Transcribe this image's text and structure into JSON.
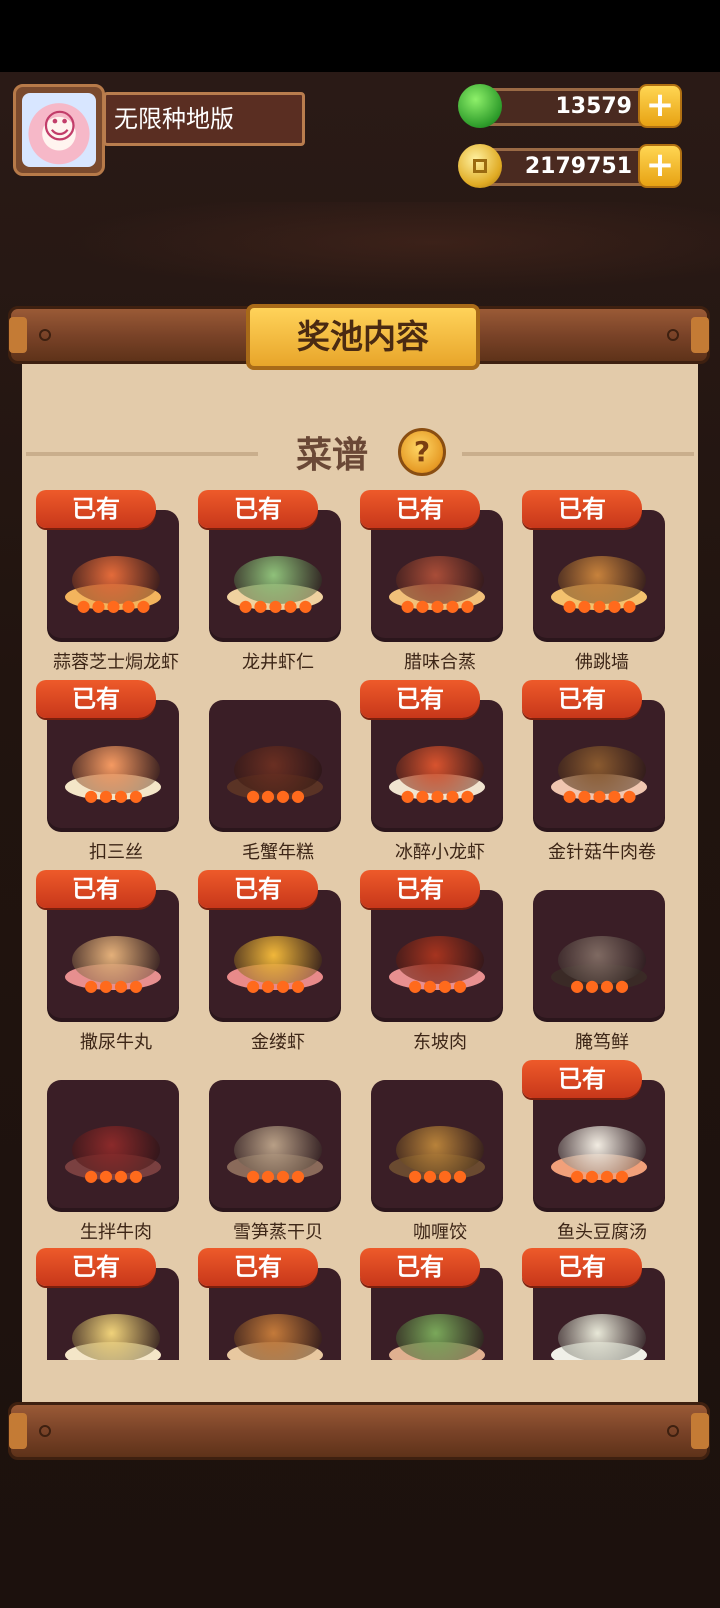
{
  "profile": {
    "name": "无限种地版"
  },
  "currencies": {
    "gems": {
      "value": "13579",
      "plus": "+"
    },
    "coins": {
      "value": "2179751",
      "plus": "+"
    }
  },
  "panel": {
    "title": "奖池内容",
    "section_title": "菜谱",
    "help": "?",
    "owned_label": "已有"
  },
  "dishes": [
    {
      "name": "蒜蓉芝士焗龙虾",
      "owned": true,
      "color": "#e46b3a",
      "plate": "#f3b45d",
      "flames": 5
    },
    {
      "name": "龙井虾仁",
      "owned": true,
      "color": "#8fc17a",
      "plate": "#f0d2a0",
      "flames": 5
    },
    {
      "name": "腊味合蒸",
      "owned": true,
      "color": "#a94d38",
      "plate": "#f1c07a",
      "flames": 5
    },
    {
      "name": "佛跳墙",
      "owned": true,
      "color": "#c7823c",
      "plate": "#f3c26e",
      "flames": 5
    },
    {
      "name": "扣三丝",
      "owned": true,
      "color": "#f59a62",
      "plate": "#f4e6c8",
      "flames": 4
    },
    {
      "name": "毛蟹年糕",
      "owned": false,
      "color": "#6a2f22",
      "plate": "#5a3325",
      "flames": 4
    },
    {
      "name": "冰醉小龙虾",
      "owned": true,
      "color": "#d8532e",
      "plate": "#f0e4d0",
      "flames": 5
    },
    {
      "name": "金针菇牛肉卷",
      "owned": true,
      "color": "#8a5a2f",
      "plate": "#f0c6b0",
      "flames": 5
    },
    {
      "name": "撒尿牛丸",
      "owned": true,
      "color": "#e4b07a",
      "plate": "#e78f8f",
      "flames": 4
    },
    {
      "name": "金缕虾",
      "owned": true,
      "color": "#f1b73a",
      "plate": "#e88a8a",
      "flames": 4
    },
    {
      "name": "东坡肉",
      "owned": true,
      "color": "#a6341f",
      "plate": "#e89090",
      "flames": 4
    },
    {
      "name": "腌笃鲜",
      "owned": false,
      "color": "#7f6a62",
      "plate": "#3a2a26",
      "flames": 4
    },
    {
      "name": "生拌牛肉",
      "owned": false,
      "color": "#8b2a2a",
      "plate": "#7a4040",
      "flames": 4
    },
    {
      "name": "雪笋蒸干贝",
      "owned": false,
      "color": "#b89f86",
      "plate": "#8a6a5a",
      "flames": 4
    },
    {
      "name": "咖喱饺",
      "owned": false,
      "color": "#b8823a",
      "plate": "#6a4a30",
      "flames": 4
    },
    {
      "name": "鱼头豆腐汤",
      "owned": true,
      "color": "#f2ece2",
      "plate": "#f1a07a",
      "flames": 4
    },
    {
      "name": "",
      "owned": true,
      "color": "#f0d27a",
      "plate": "#f4e6c8",
      "flames": 0
    },
    {
      "name": "",
      "owned": true,
      "color": "#c47a3a",
      "plate": "#e8c8a0",
      "flames": 0
    },
    {
      "name": "",
      "owned": true,
      "color": "#7aa85a",
      "plate": "#e0b090",
      "flames": 0
    },
    {
      "name": "",
      "owned": true,
      "color": "#e8e8d8",
      "plate": "#f0f0e8",
      "flames": 0
    }
  ]
}
